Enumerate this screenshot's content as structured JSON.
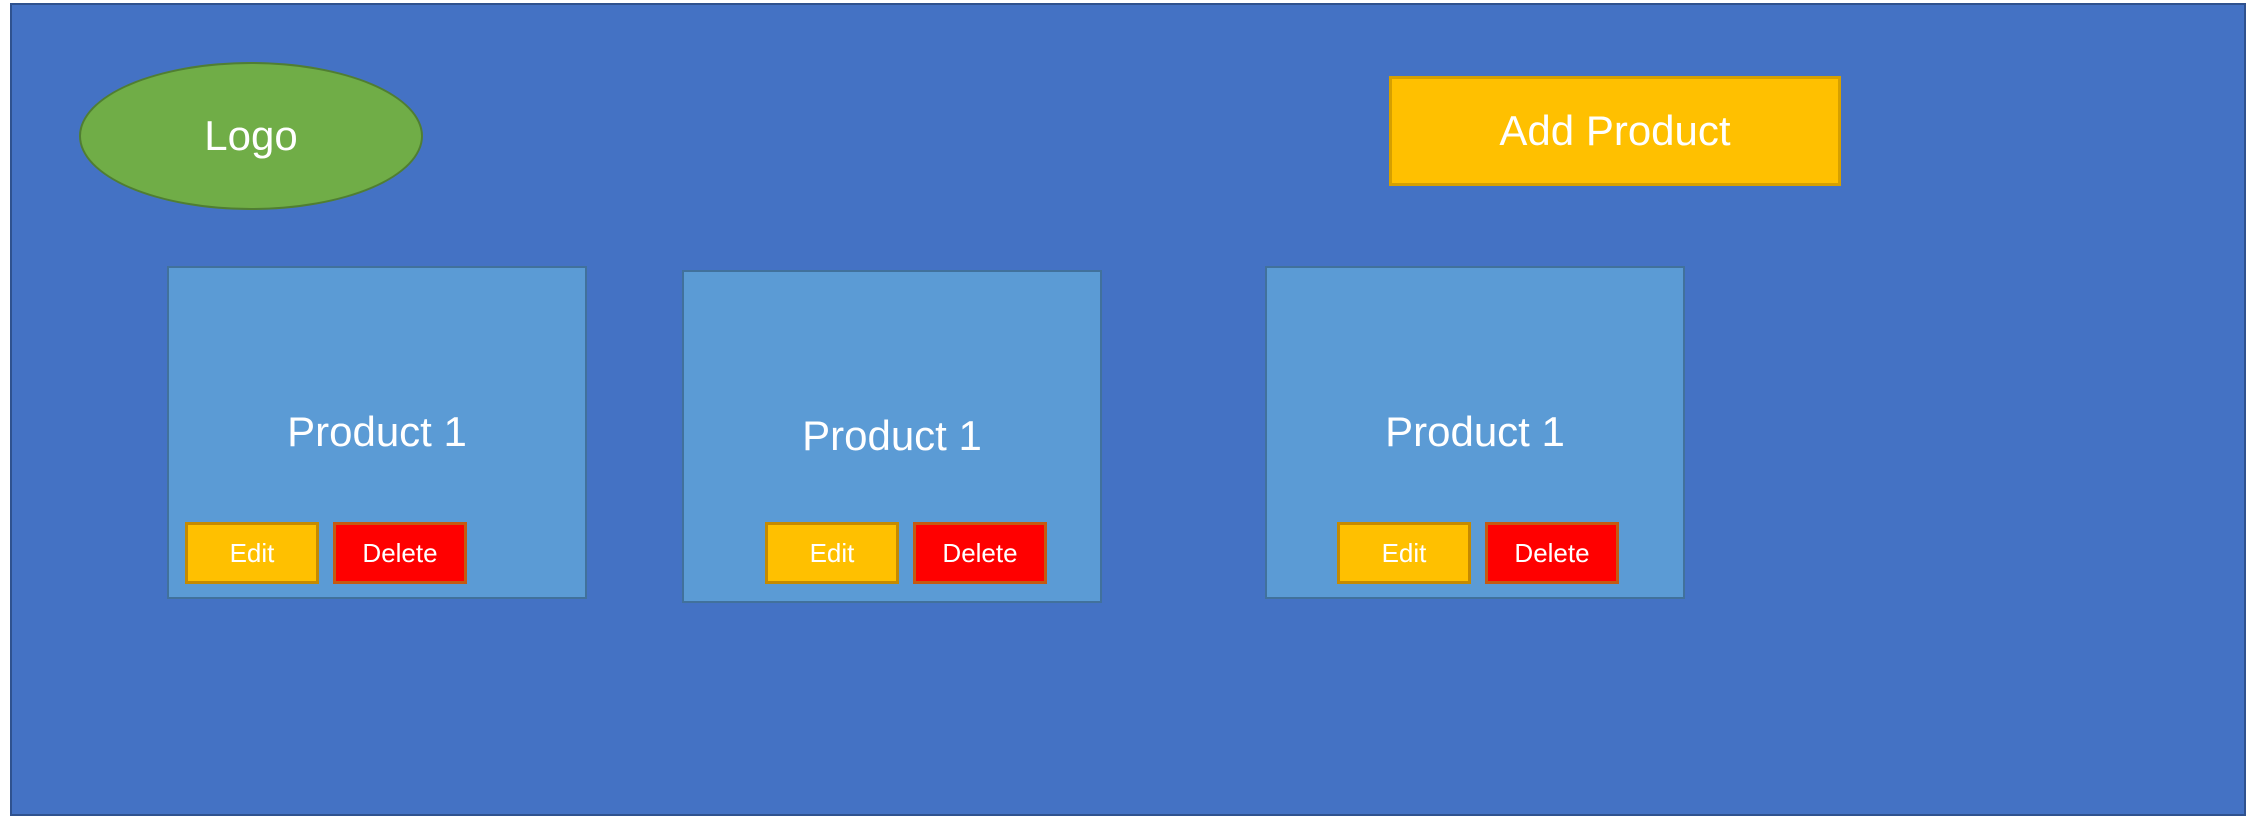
{
  "header": {
    "logo_label": "Logo",
    "add_product_label": "Add Product"
  },
  "products": [
    {
      "title": "Product 1",
      "edit_label": "Edit",
      "delete_label": "Delete"
    },
    {
      "title": "Product 1",
      "edit_label": "Edit",
      "delete_label": "Delete"
    },
    {
      "title": "Product 1",
      "edit_label": "Edit",
      "delete_label": "Delete"
    }
  ],
  "colors": {
    "background": "#4472c4",
    "logo": "#70ad47",
    "card": "#5b9bd5",
    "edit_button": "#ffc000",
    "delete_button": "#ff0000",
    "add_button": "#ffc000"
  }
}
